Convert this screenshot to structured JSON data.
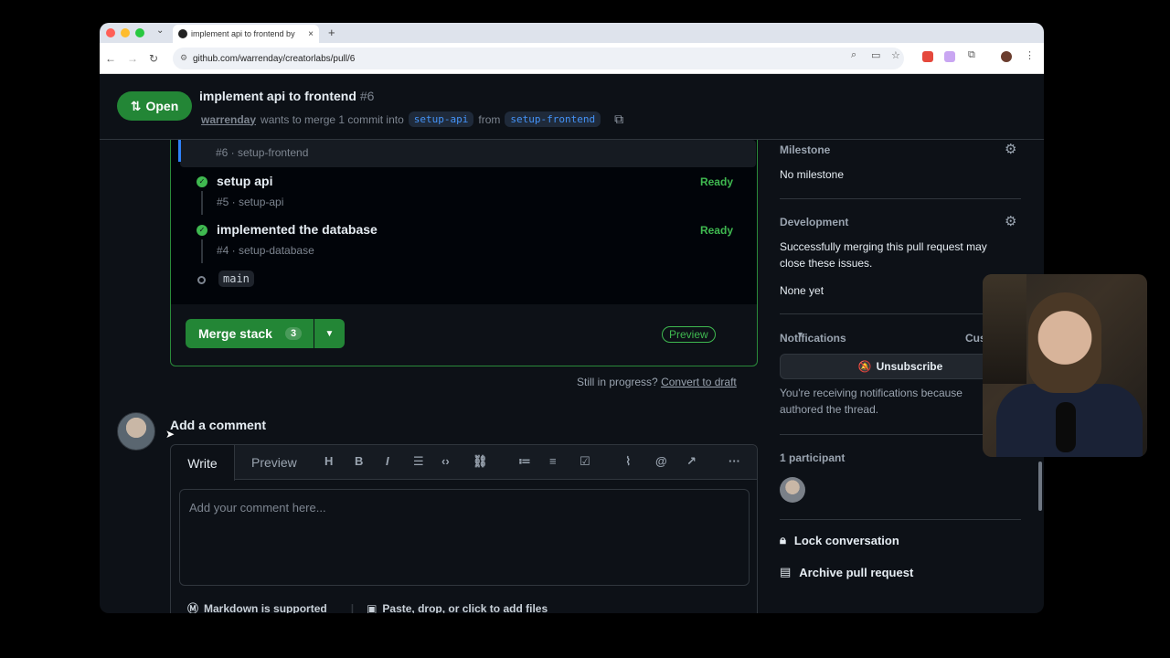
{
  "browser": {
    "tab_title": "implement api to frontend by",
    "url": "github.com/warrenday/creatorlabs/pull/6",
    "new_tab": "+",
    "close": "×"
  },
  "header": {
    "state": "Open",
    "title": "implement api to frontend",
    "number": "#6",
    "author": "warrenday",
    "meta_text": "wants to merge 1 commit into",
    "base_branch": "setup-api",
    "from": "from",
    "head_branch": "setup-frontend"
  },
  "stack": {
    "current_sub": "#6 · setup-frontend",
    "items": [
      {
        "title": "setup api",
        "sub": "#5 · setup-api",
        "status": "Ready"
      },
      {
        "title": "implemented the database",
        "sub": "#4 · setup-database",
        "status": "Ready"
      }
    ],
    "base": "main",
    "merge_label": "Merge stack",
    "merge_count": "3",
    "preview": "Preview"
  },
  "draft": {
    "question": "Still in progress?",
    "link": "Convert to draft"
  },
  "comment": {
    "heading": "Add a comment",
    "tab_write": "Write",
    "tab_preview": "Preview",
    "placeholder": "Add your comment here...",
    "markdown": "Markdown is supported",
    "attach": "Paste, drop, or click to add files",
    "toolbar_heading": "H",
    "toolbar_bold": "B",
    "toolbar_italic": "I",
    "toolbar_more": "···"
  },
  "sidebar": {
    "milestone_label": "Milestone",
    "milestone_value": "No milestone",
    "development_label": "Development",
    "development_text_1": "Successfully merging this pull request may",
    "development_text_2": "close these issues.",
    "development_value": "None yet",
    "notifications_label": "Notifications",
    "notifications_customize": "Cus",
    "unsubscribe": "Unsubscribe",
    "notif_reason_1": "You're receiving notifications because",
    "notif_reason_2": "authored the thread.",
    "participants": "1 participant",
    "lock": "Lock conversation",
    "archive": "Archive pull request"
  },
  "colors": {
    "accent_green": "#238636",
    "ready_green": "#3fb950",
    "link_blue": "#4493f8",
    "bg": "#0d1117"
  }
}
